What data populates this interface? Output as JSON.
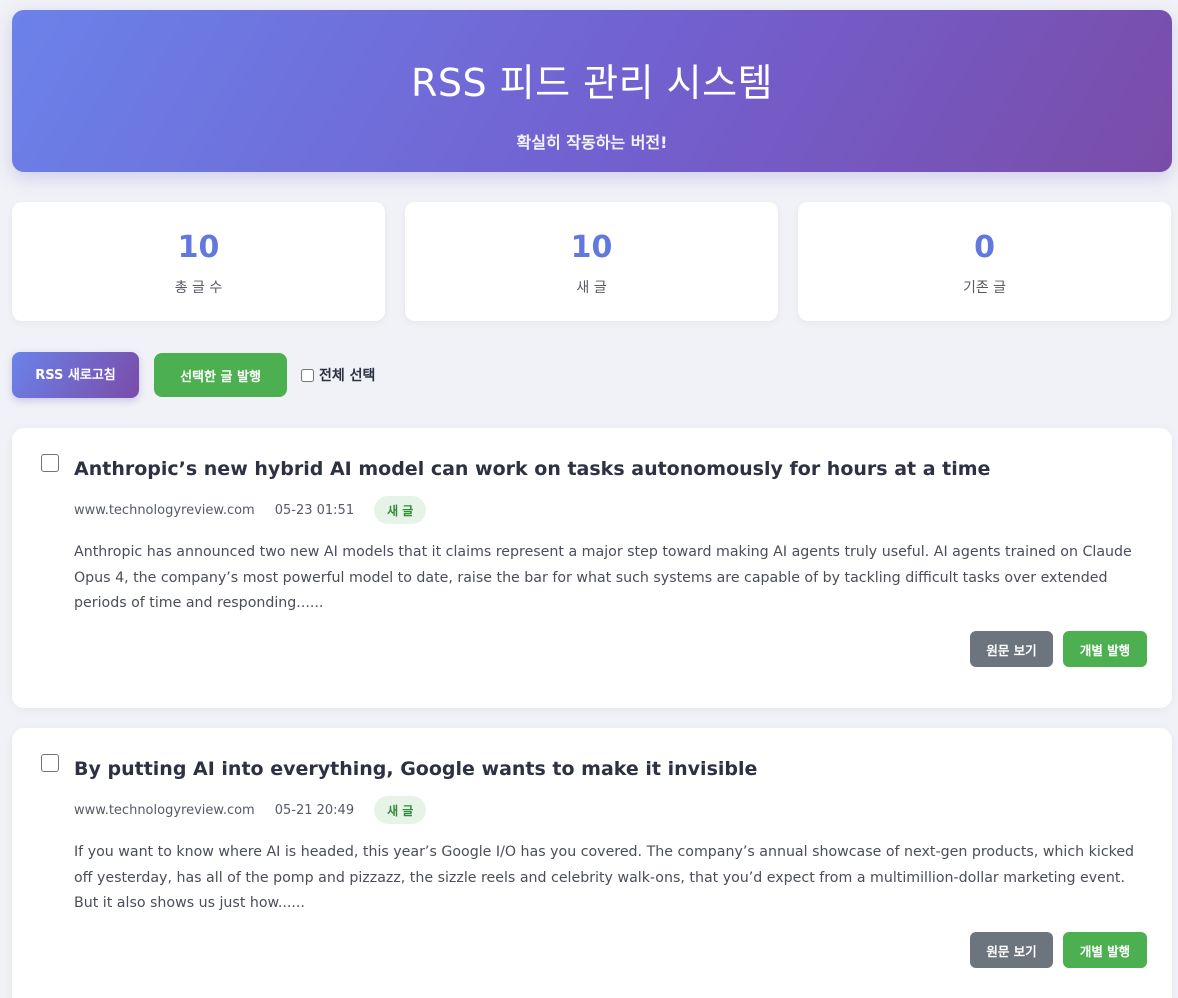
{
  "header": {
    "title": "RSS 피드 관리 시스템",
    "subtitle": "확실히 작동하는 버전!"
  },
  "stats": [
    {
      "value": "10",
      "label": "총 글 수"
    },
    {
      "value": "10",
      "label": "새 글"
    },
    {
      "value": "0",
      "label": "기존 글"
    }
  ],
  "toolbar": {
    "refresh_label": "RSS 새로고침",
    "publish_selected_label": "선택한 글 발행",
    "select_all_label": "전체 선택"
  },
  "articles": [
    {
      "title": "Anthropic’s new hybrid AI model can work on tasks autonomously for hours at a time",
      "source": "www.technologyreview.com",
      "date": "05-23 01:51",
      "badge": "새 글",
      "summary": "Anthropic has announced two new AI models that it claims represent a major step toward making AI agents truly useful. AI agents trained on Claude Opus 4, the company’s most powerful model to date, raise the bar for what such systems are capable of by tackling difficult tasks over extended periods of time and responding......",
      "view_label": "원문 보기",
      "publish_label": "개별 발행"
    },
    {
      "title": "By putting AI into everything, Google wants to make it invisible",
      "source": "www.technologyreview.com",
      "date": "05-21 20:49",
      "badge": "새 글",
      "summary": "If you want to know where AI is headed, this year’s Google I/O has you covered. The company’s annual showcase of next-gen products, which kicked off yesterday, has all of the pomp and pizzazz, the sizzle reels and celebrity walk-ons, that you’d expect from a multimillion-dollar marketing event. But it also shows us just how......",
      "view_label": "원문 보기",
      "publish_label": "개별 발행"
    }
  ],
  "colors": {
    "accent": "#6378de",
    "success": "#4caf50",
    "secondary": "#6c757d"
  }
}
